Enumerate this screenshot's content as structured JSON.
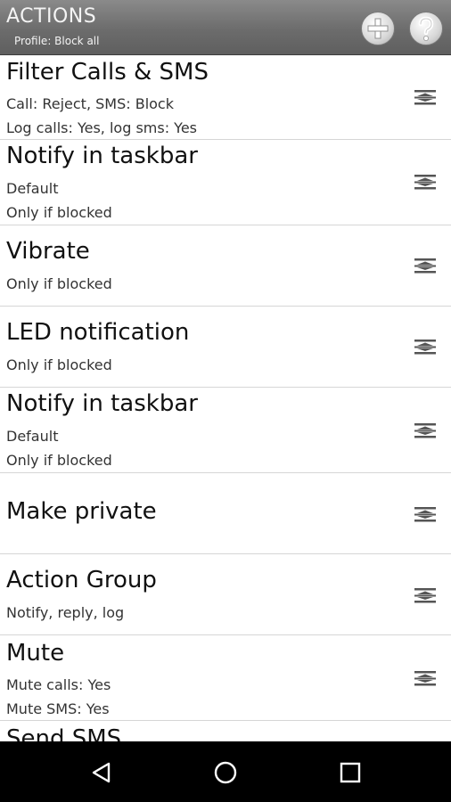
{
  "header": {
    "title": "ACTIONS",
    "subtitle": "Profile: Block all",
    "add_icon": "plus-icon",
    "help_icon": "question-icon"
  },
  "actions": [
    {
      "title": "Filter Calls & SMS",
      "lines": [
        "Call: Reject, SMS: Block",
        "Log calls: Yes, log sms: Yes"
      ]
    },
    {
      "title": "Notify in taskbar",
      "lines": [
        "Default",
        "Only if blocked"
      ]
    },
    {
      "title": "Vibrate",
      "lines": [
        "Only if blocked"
      ]
    },
    {
      "title": "LED notification",
      "lines": [
        "Only if blocked"
      ]
    },
    {
      "title": "Notify in taskbar",
      "lines": [
        "Default",
        "Only if blocked"
      ]
    },
    {
      "title": "Make private",
      "lines": []
    },
    {
      "title": "Action Group",
      "lines": [
        "Notify, reply, log"
      ]
    },
    {
      "title": "Mute",
      "lines": [
        "Mute calls: Yes",
        "Mute SMS: Yes"
      ]
    },
    {
      "title": "Send SMS",
      "lines": []
    }
  ],
  "row_menu_icon": "drag-handle-icon",
  "navbar": {
    "back_icon": "back-triangle-icon",
    "home_icon": "home-circle-icon",
    "recent_icon": "recent-apps-square-icon"
  },
  "colors": {
    "header_bg": "#6c6c6c",
    "header_text": "#f4f4f4",
    "list_bg": "#ffffff",
    "title_text": "#111111",
    "detail_text": "#333333",
    "divider": "#d6d6d6",
    "navbar_bg": "#000000"
  }
}
